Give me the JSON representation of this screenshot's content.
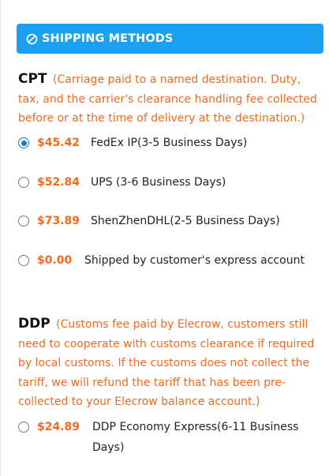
{
  "header": {
    "title": "SHIPPING METHODS",
    "icon": "no-entry-icon",
    "bg_color": "#1ca0f2"
  },
  "accent_color": "#f06a1f",
  "sections": [
    {
      "code": "CPT",
      "description": "(Carriage paid to a named destination. Duty, tax, and the carrier's clearance handling fee collected before or at the time of delivery at the destination.)",
      "options": [
        {
          "price": "$45.42",
          "label": "FedEx IP(3-5 Business Days)",
          "selected": true
        },
        {
          "price": "$52.84",
          "label": "UPS (3-6 Business Days)",
          "selected": false
        },
        {
          "price": "$73.89",
          "label": "ShenZhenDHL(2-5 Business Days)",
          "selected": false
        },
        {
          "price": "$0.00",
          "label": "Shipped by customer's express account",
          "selected": false
        }
      ]
    },
    {
      "code": "DDP",
      "description": "(Customs fee paid by Elecrow, customers still need to cooperate with customs clearance if required by local customs. If the customs does not collect the tariff, we will refund the tariff that has been pre-collected to your Elecrow balance account.)",
      "options": [
        {
          "price": "$24.89",
          "label": "DDP Economy Express(6-11 Business Days)",
          "selected": false
        }
      ]
    }
  ]
}
